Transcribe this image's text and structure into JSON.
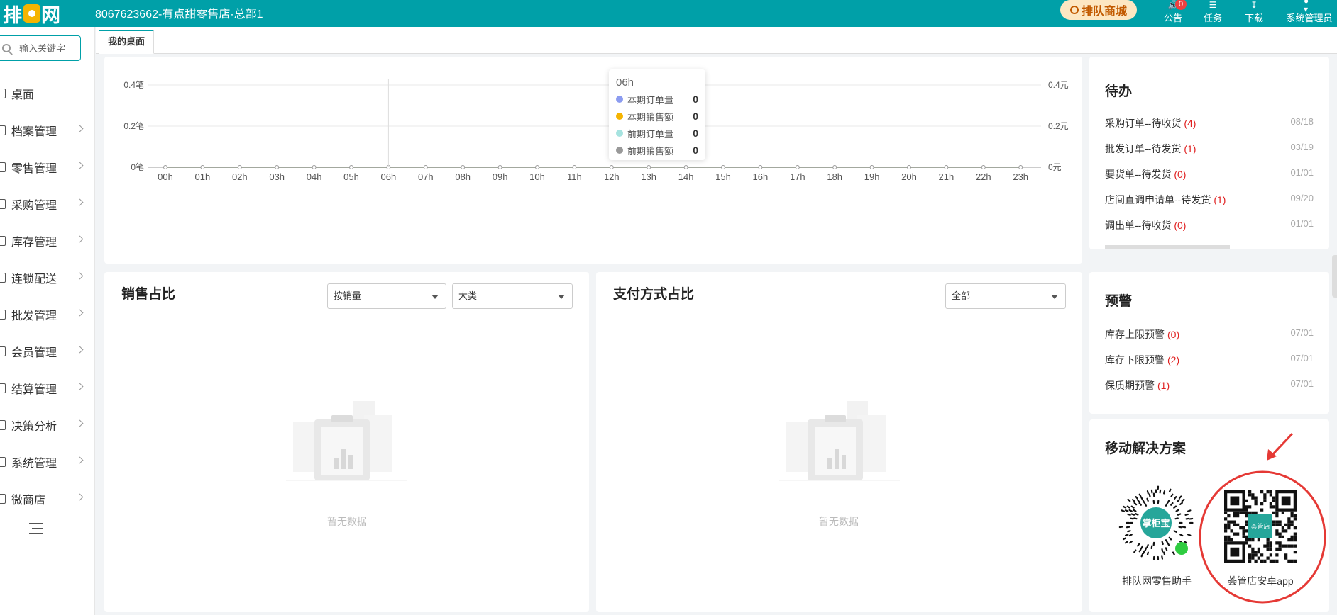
{
  "header": {
    "logo_text_left": "排",
    "logo_text_right": "网",
    "store_title": "8067623662-有点甜零售店-总部1",
    "mall_label": "排队商城",
    "items": [
      {
        "label": "公告",
        "badge": "0",
        "icon": "speaker-icon"
      },
      {
        "label": "任务",
        "icon": "task-icon"
      },
      {
        "label": "下载",
        "icon": "download-icon"
      },
      {
        "label": "系统管理员",
        "icon": "user-icon"
      }
    ]
  },
  "sidebar": {
    "search_placeholder": "输入关键字",
    "items": [
      {
        "label": "桌面",
        "has_children": false
      },
      {
        "label": "档案管理",
        "has_children": true
      },
      {
        "label": "零售管理",
        "has_children": true
      },
      {
        "label": "采购管理",
        "has_children": true
      },
      {
        "label": "库存管理",
        "has_children": true
      },
      {
        "label": "连锁配送",
        "has_children": true
      },
      {
        "label": "批发管理",
        "has_children": true
      },
      {
        "label": "会员管理",
        "has_children": true
      },
      {
        "label": "结算管理",
        "has_children": true
      },
      {
        "label": "决策分析",
        "has_children": true
      },
      {
        "label": "系统管理",
        "has_children": true
      },
      {
        "label": "微商店",
        "has_children": true
      }
    ]
  },
  "tabs": [
    {
      "label": "我的桌面",
      "active": true
    }
  ],
  "chart_data": {
    "type": "line",
    "x": [
      "00h",
      "01h",
      "02h",
      "03h",
      "04h",
      "05h",
      "06h",
      "07h",
      "08h",
      "09h",
      "10h",
      "11h",
      "12h",
      "13h",
      "14h",
      "15h",
      "16h",
      "17h",
      "18h",
      "19h",
      "20h",
      "21h",
      "22h",
      "23h"
    ],
    "y_left_ticks": [
      "0.4笔",
      "0.2笔",
      "0笔"
    ],
    "y_right_ticks": [
      "0.4元",
      "0.2元",
      "0元"
    ],
    "ylim": [
      0,
      0.4
    ],
    "series": [
      {
        "name": "本期订单量",
        "color": "#8c9cf0",
        "values": [
          0,
          0,
          0,
          0,
          0,
          0,
          0,
          0,
          0,
          0,
          0,
          0,
          0,
          0,
          0,
          0,
          0,
          0,
          0,
          0,
          0,
          0,
          0,
          0
        ]
      },
      {
        "name": "本期销售额",
        "color": "#f5b400",
        "values": [
          0,
          0,
          0,
          0,
          0,
          0,
          0,
          0,
          0,
          0,
          0,
          0,
          0,
          0,
          0,
          0,
          0,
          0,
          0,
          0,
          0,
          0,
          0,
          0
        ]
      },
      {
        "name": "前期订单量",
        "color": "#a6e3e0",
        "values": [
          0,
          0,
          0,
          0,
          0,
          0,
          0,
          0,
          0,
          0,
          0,
          0,
          0,
          0,
          0,
          0,
          0,
          0,
          0,
          0,
          0,
          0,
          0,
          0
        ]
      },
      {
        "name": "前期销售额",
        "color": "#999999",
        "values": [
          0,
          0,
          0,
          0,
          0,
          0,
          0,
          0,
          0,
          0,
          0,
          0,
          0,
          0,
          0,
          0,
          0,
          0,
          0,
          0,
          0,
          0,
          0,
          0
        ]
      }
    ],
    "tooltip": {
      "x_label": "06h",
      "values": [
        "0",
        "0",
        "0",
        "0"
      ]
    }
  },
  "todo": {
    "title": "待办",
    "items": [
      {
        "label": "采购订单--待收货",
        "count": "(4)",
        "date": "08/18"
      },
      {
        "label": "批发订单--待发货",
        "count": "(1)",
        "date": "03/19"
      },
      {
        "label": "要货单--待发货",
        "count": "(0)",
        "date": "01/01"
      },
      {
        "label": "店间直调申请单--待发货",
        "count": "(1)",
        "date": "09/20"
      },
      {
        "label": "调出单--待收货",
        "count": "(0)",
        "date": "01/01"
      }
    ]
  },
  "warning": {
    "title": "预警",
    "items": [
      {
        "label": "库存上限预警",
        "count": "(0)",
        "date": "07/01"
      },
      {
        "label": "库存下限预警",
        "count": "(2)",
        "date": "07/01"
      },
      {
        "label": "保质期预警",
        "count": "(1)",
        "date": "07/01"
      }
    ]
  },
  "sales_share": {
    "title": "销售占比",
    "select1": "按销量",
    "select2": "大类",
    "empty": "暂无数据"
  },
  "payment_share": {
    "title": "支付方式占比",
    "select1": "全部",
    "empty": "暂无数据"
  },
  "mobile": {
    "title": "移动解决方案",
    "qr1_label": "排队网零售助手",
    "qr1_center_text": "掌柜宝",
    "qr2_label": "荟管店安卓app",
    "qr2_center_text": "荟管店",
    "highlight_color": "#e53935"
  }
}
